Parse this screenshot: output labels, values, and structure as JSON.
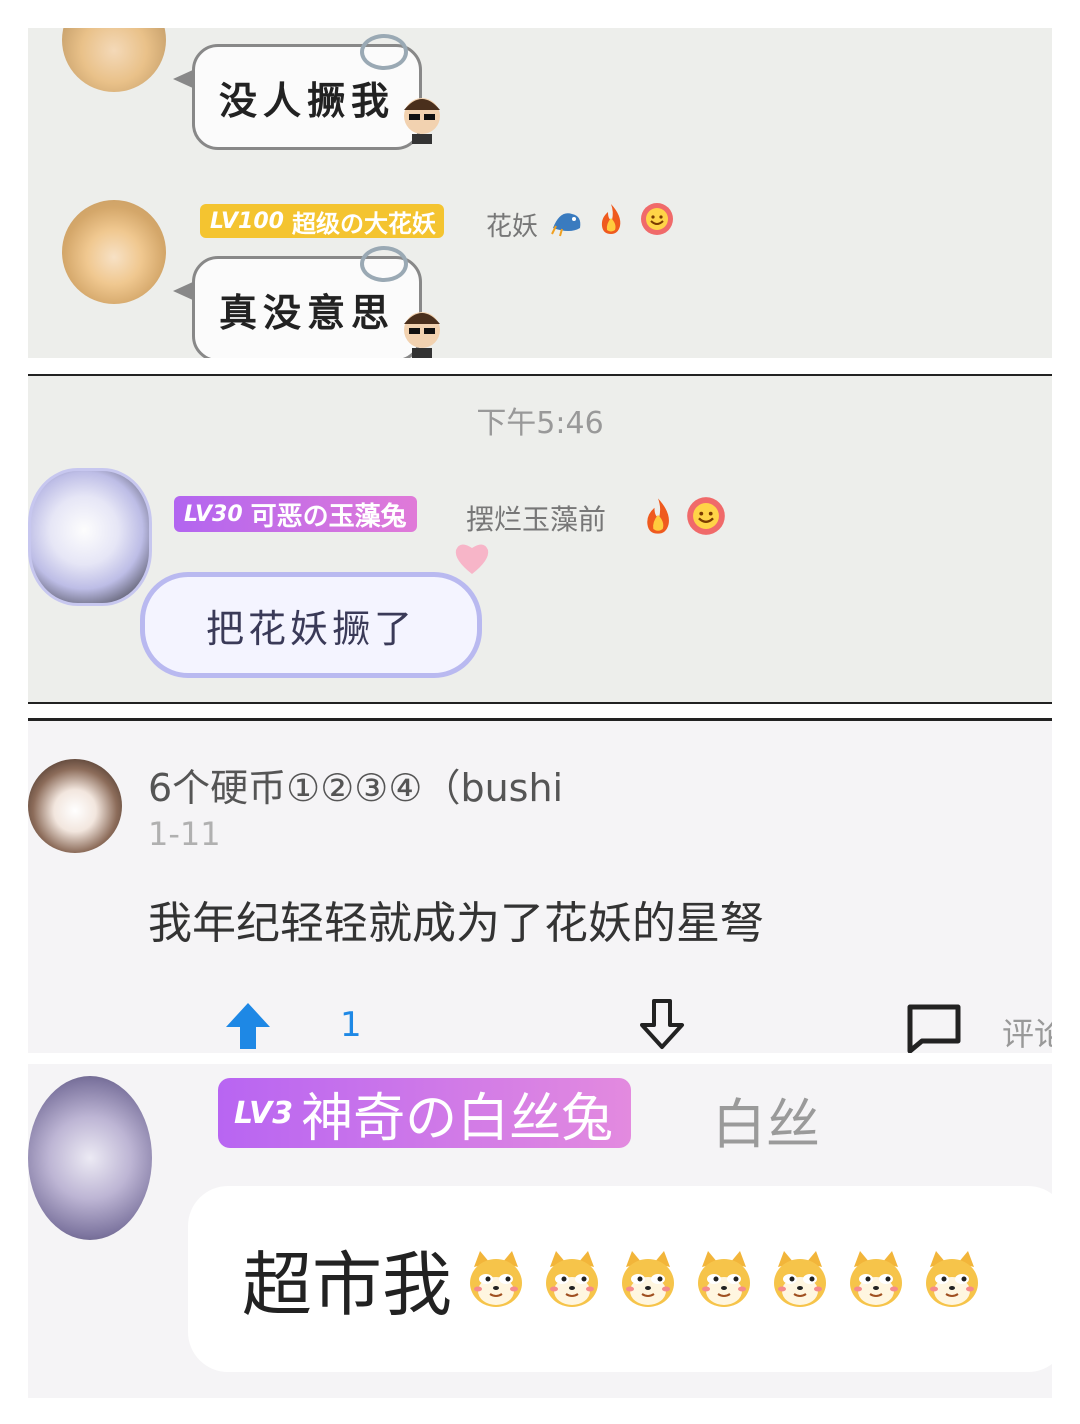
{
  "panel1": {
    "msg1": "没人撅我",
    "user": {
      "level": "LV100",
      "badge_name": "超级の大花妖",
      "nickname": "花妖"
    },
    "msg2": "真没意思"
  },
  "panel2": {
    "time": "下午5:46",
    "user": {
      "level": "LV30",
      "badge_name": "可恶の玉藻兔",
      "nickname": "摆烂玉藻前"
    },
    "msg": "把花妖撅了"
  },
  "panel3": {
    "username": "6个硬币①②③④（bushi",
    "date": "1-11",
    "content": "我年纪轻轻就成为了花妖的星弩",
    "like_count": "1",
    "comment_label": "评论"
  },
  "panel4": {
    "user": {
      "level": "LV3",
      "badge_name": "神奇の白丝兔",
      "nickname": "白丝"
    },
    "msg": "超市我",
    "emoji_count": 7
  },
  "colors": {
    "gold_badge": "#f4c430",
    "purple_badge": "#c67ae8",
    "like_blue": "#1e88e5",
    "panel_gray": "#edeeeb"
  },
  "icons": [
    "upvote-arrow-icon",
    "downvote-arrow-icon",
    "comment-icon",
    "fire-icon",
    "smile-flower-icon",
    "dragon-icon",
    "cheems-emoji"
  ]
}
